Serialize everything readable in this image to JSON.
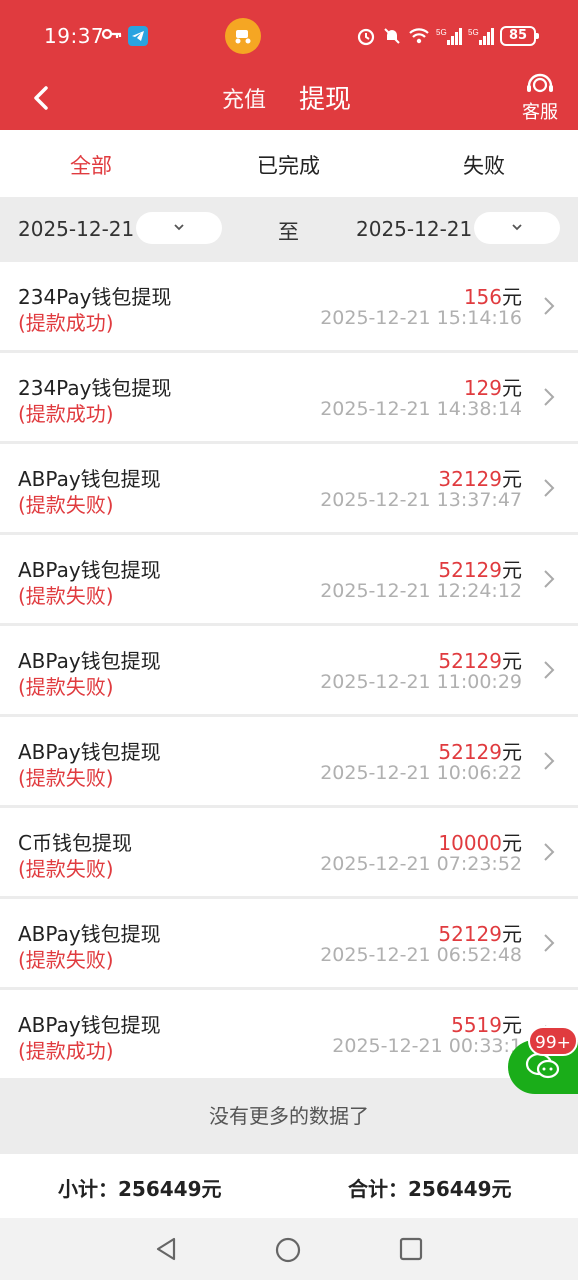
{
  "status_bar": {
    "time": "19:37",
    "battery": "85"
  },
  "nav": {
    "tab_charge": "充值",
    "tab_withdraw": "提现",
    "customer_service": "客服"
  },
  "filters": [
    "全部",
    "已完成",
    "失败"
  ],
  "date_range": {
    "from": "2025-12-21",
    "separator": "至",
    "to": "2025-12-21"
  },
  "records": [
    {
      "title": "234Pay钱包提现",
      "status": "(提款成功)",
      "amount": "156",
      "unit": "元",
      "time": "2025-12-21 15:14:16"
    },
    {
      "title": "234Pay钱包提现",
      "status": "(提款成功)",
      "amount": "129",
      "unit": "元",
      "time": "2025-12-21 14:38:14"
    },
    {
      "title": "ABPay钱包提现",
      "status": "(提款失败)",
      "amount": "32129",
      "unit": "元",
      "time": "2025-12-21 13:37:47"
    },
    {
      "title": "ABPay钱包提现",
      "status": "(提款失败)",
      "amount": "52129",
      "unit": "元",
      "time": "2025-12-21 12:24:12"
    },
    {
      "title": "ABPay钱包提现",
      "status": "(提款失败)",
      "amount": "52129",
      "unit": "元",
      "time": "2025-12-21 11:00:29"
    },
    {
      "title": "ABPay钱包提现",
      "status": "(提款失败)",
      "amount": "52129",
      "unit": "元",
      "time": "2025-12-21 10:06:22"
    },
    {
      "title": "C币钱包提现",
      "status": "(提款失败)",
      "amount": "10000",
      "unit": "元",
      "time": "2025-12-21 07:23:52"
    },
    {
      "title": "ABPay钱包提现",
      "status": "(提款失败)",
      "amount": "52129",
      "unit": "元",
      "time": "2025-12-21 06:52:48"
    },
    {
      "title": "ABPay钱包提现",
      "status": "(提款成功)",
      "amount": "5519",
      "unit": "元",
      "time": "2025-12-21 00:33:1"
    }
  ],
  "no_more": "没有更多的数据了",
  "totals": {
    "subtotal": "小计：256449元",
    "total": "合计：256449元"
  },
  "chat_badge": "99+",
  "colors": {
    "brand_red": "#e03b3f",
    "chat_green": "#1aad19"
  }
}
